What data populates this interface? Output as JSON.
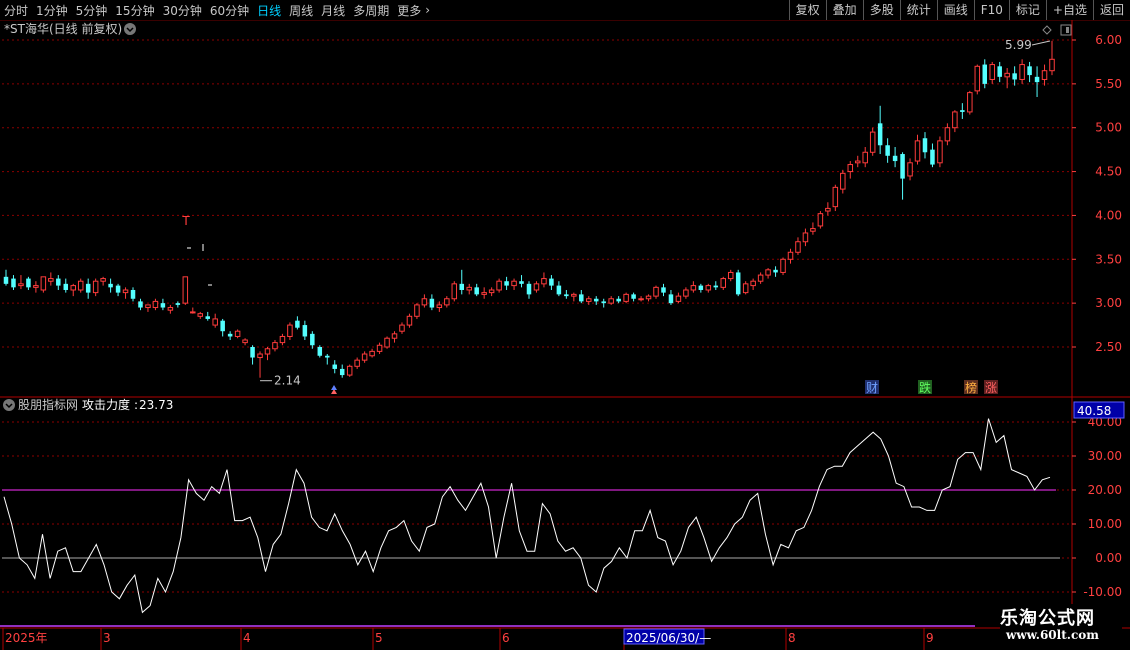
{
  "toolbar": {
    "left_items": [
      "分时",
      "1分钟",
      "5分钟",
      "15分钟",
      "30分钟",
      "60分钟",
      "日线",
      "周线",
      "月线",
      "多周期",
      "更多"
    ],
    "active": "日线",
    "right_items": [
      "复权",
      "叠加",
      "多股",
      "统计",
      "画线",
      "F10",
      "标记",
      "+自选",
      "返回"
    ]
  },
  "main_panel": {
    "title": "*ST海华(日线 前复权)",
    "max_label": "5.99",
    "min_label": "2.14",
    "event_markers": [
      "财",
      "跌",
      "榜",
      "涨"
    ],
    "t_marker": "T"
  },
  "indicator_panel": {
    "title": "股朋指标网",
    "indicator_name": "攻击力度",
    "indicator_value": "23.73",
    "current_value_box": "40.58"
  },
  "time_axis": {
    "labels": [
      "2025年",
      "3",
      "4",
      "5",
      "6",
      "2025/06/30/—",
      "8",
      "9"
    ]
  },
  "watermark": {
    "line1": "乐淘公式网",
    "line2": "www.60lt.com"
  },
  "colors": {
    "up": "#ff3c3c",
    "down": "#54ffff",
    "grid": "#8b0000",
    "indicator_line": "#ffffff",
    "level_line": "#ff30ff",
    "axis_text": "#ff4040"
  },
  "chart_data": [
    {
      "type": "candlestick",
      "title": "*ST海华(日线 前复权)",
      "y_axis": {
        "ticks": [
          2.5,
          3.0,
          3.5,
          4.0,
          4.5,
          5.0,
          5.5,
          6.0
        ],
        "range": [
          2.05,
          6.1
        ],
        "grid": true
      },
      "x_labels": [
        "2025年",
        "3",
        "4",
        "5",
        "6",
        "2025/06/30/—",
        "8",
        "9"
      ],
      "candles": [
        [
          3.3,
          3.38,
          3.22,
          3.2
        ],
        [
          3.28,
          3.32,
          3.18,
          3.15
        ],
        [
          3.2,
          3.32,
          3.22,
          3.16
        ],
        [
          3.28,
          3.3,
          3.18,
          3.15
        ],
        [
          3.18,
          3.25,
          3.2,
          3.12
        ],
        [
          3.15,
          3.22,
          3.3,
          3.12
        ],
        [
          3.25,
          3.35,
          3.28,
          3.2
        ],
        [
          3.28,
          3.32,
          3.2,
          3.15
        ],
        [
          3.22,
          3.28,
          3.15,
          3.12
        ],
        [
          3.15,
          3.22,
          3.2,
          3.08
        ],
        [
          3.15,
          3.28,
          3.25,
          3.12
        ],
        [
          3.22,
          3.28,
          3.12,
          3.05
        ],
        [
          3.12,
          3.28,
          3.25,
          3.08
        ],
        [
          3.25,
          3.3,
          3.28,
          3.2
        ],
        [
          3.22,
          3.28,
          3.18,
          3.12
        ],
        [
          3.2,
          3.22,
          3.12,
          3.08
        ],
        [
          3.12,
          3.18,
          3.15,
          3.05
        ],
        [
          3.15,
          3.18,
          3.05,
          3.02
        ],
        [
          3.02,
          3.05,
          2.95,
          2.92
        ],
        [
          2.95,
          2.98,
          2.98,
          2.9
        ],
        [
          2.95,
          3.05,
          3.02,
          2.92
        ],
        [
          3.0,
          3.05,
          2.95,
          2.92
        ],
        [
          2.92,
          2.98,
          2.95,
          2.88
        ],
        [
          3.0,
          3.02,
          2.98,
          2.95
        ],
        [
          3.0,
          3.3,
          3.3,
          2.98
        ],
        [
          2.9,
          2.95,
          2.9,
          2.88
        ],
        [
          2.85,
          2.9,
          2.88,
          2.82
        ],
        [
          2.85,
          2.9,
          2.82,
          2.8
        ],
        [
          2.75,
          2.88,
          2.82,
          2.72
        ],
        [
          2.8,
          2.82,
          2.68,
          2.62
        ],
        [
          2.65,
          2.68,
          2.62,
          2.58
        ],
        [
          2.62,
          2.7,
          2.68,
          2.6
        ],
        [
          2.55,
          2.6,
          2.58,
          2.52
        ],
        [
          2.5,
          2.52,
          2.38,
          2.3
        ],
        [
          2.38,
          2.45,
          2.42,
          2.15
        ],
        [
          2.42,
          2.5,
          2.48,
          2.35
        ],
        [
          2.48,
          2.58,
          2.55,
          2.45
        ],
        [
          2.55,
          2.65,
          2.62,
          2.52
        ],
        [
          2.62,
          2.78,
          2.75,
          2.58
        ],
        [
          2.8,
          2.85,
          2.72,
          2.7
        ],
        [
          2.75,
          2.8,
          2.62,
          2.58
        ],
        [
          2.65,
          2.68,
          2.52,
          2.48
        ],
        [
          2.5,
          2.52,
          2.4,
          2.38
        ],
        [
          2.4,
          2.42,
          2.38,
          2.3
        ],
        [
          2.3,
          2.35,
          2.25,
          2.2
        ],
        [
          2.25,
          2.3,
          2.18,
          2.15
        ],
        [
          2.18,
          2.3,
          2.28,
          2.16
        ],
        [
          2.28,
          2.38,
          2.35,
          2.25
        ],
        [
          2.35,
          2.45,
          2.42,
          2.32
        ],
        [
          2.4,
          2.48,
          2.45,
          2.38
        ],
        [
          2.45,
          2.55,
          2.52,
          2.42
        ],
        [
          2.5,
          2.62,
          2.6,
          2.48
        ],
        [
          2.6,
          2.68,
          2.65,
          2.55
        ],
        [
          2.68,
          2.78,
          2.75,
          2.65
        ],
        [
          2.75,
          2.88,
          2.85,
          2.72
        ],
        [
          2.85,
          3.0,
          2.98,
          2.82
        ],
        [
          2.98,
          3.1,
          3.05,
          2.95
        ],
        [
          3.05,
          3.1,
          2.95,
          2.92
        ],
        [
          2.95,
          3.02,
          2.98,
          2.9
        ],
        [
          2.98,
          3.08,
          3.05,
          2.95
        ],
        [
          3.05,
          3.25,
          3.22,
          3.02
        ],
        [
          3.22,
          3.38,
          3.15,
          3.1
        ],
        [
          3.15,
          3.22,
          3.18,
          3.1
        ],
        [
          3.18,
          3.22,
          3.1,
          3.08
        ],
        [
          3.1,
          3.18,
          3.12,
          3.05
        ],
        [
          3.12,
          3.18,
          3.15,
          3.08
        ],
        [
          3.15,
          3.28,
          3.25,
          3.12
        ],
        [
          3.25,
          3.3,
          3.2,
          3.15
        ],
        [
          3.2,
          3.28,
          3.25,
          3.15
        ],
        [
          3.25,
          3.32,
          3.22,
          3.18
        ],
        [
          3.22,
          3.25,
          3.1,
          3.05
        ],
        [
          3.15,
          3.25,
          3.22,
          3.12
        ],
        [
          3.22,
          3.35,
          3.28,
          3.18
        ],
        [
          3.28,
          3.32,
          3.2,
          3.15
        ],
        [
          3.2,
          3.25,
          3.1,
          3.08
        ],
        [
          3.1,
          3.15,
          3.08,
          3.05
        ],
        [
          3.08,
          3.12,
          3.1,
          3.02
        ],
        [
          3.1,
          3.15,
          3.02,
          3.0
        ],
        [
          3.02,
          3.08,
          3.05,
          2.98
        ],
        [
          3.05,
          3.08,
          3.02,
          2.98
        ],
        [
          3.02,
          3.05,
          3.0,
          2.95
        ],
        [
          3.0,
          3.08,
          3.05,
          2.98
        ],
        [
          3.05,
          3.08,
          3.02,
          3.0
        ],
        [
          3.02,
          3.12,
          3.1,
          3.0
        ],
        [
          3.1,
          3.12,
          3.05,
          3.02
        ],
        [
          3.05,
          3.08,
          3.05,
          3.02
        ],
        [
          3.05,
          3.1,
          3.08,
          3.02
        ],
        [
          3.08,
          3.2,
          3.18,
          3.05
        ],
        [
          3.18,
          3.22,
          3.12,
          3.08
        ],
        [
          3.1,
          3.15,
          3.0,
          2.98
        ],
        [
          3.02,
          3.12,
          3.08,
          3.0
        ],
        [
          3.08,
          3.18,
          3.15,
          3.05
        ],
        [
          3.15,
          3.25,
          3.2,
          3.12
        ],
        [
          3.2,
          3.22,
          3.15,
          3.12
        ],
        [
          3.15,
          3.22,
          3.2,
          3.12
        ],
        [
          3.2,
          3.25,
          3.18,
          3.15
        ],
        [
          3.18,
          3.3,
          3.28,
          3.15
        ],
        [
          3.28,
          3.38,
          3.35,
          3.25
        ],
        [
          3.35,
          3.38,
          3.1,
          3.08
        ],
        [
          3.12,
          3.25,
          3.22,
          3.1
        ],
        [
          3.2,
          3.28,
          3.25,
          3.15
        ],
        [
          3.25,
          3.35,
          3.32,
          3.22
        ],
        [
          3.32,
          3.4,
          3.38,
          3.28
        ],
        [
          3.38,
          3.42,
          3.35,
          3.3
        ],
        [
          3.35,
          3.52,
          3.5,
          3.32
        ],
        [
          3.5,
          3.62,
          3.58,
          3.45
        ],
        [
          3.58,
          3.75,
          3.7,
          3.55
        ],
        [
          3.7,
          3.85,
          3.8,
          3.65
        ],
        [
          3.82,
          3.92,
          3.85,
          3.78
        ],
        [
          3.88,
          4.05,
          4.02,
          3.85
        ],
        [
          4.05,
          4.15,
          4.08,
          4.0
        ],
        [
          4.1,
          4.35,
          4.32,
          4.05
        ],
        [
          4.3,
          4.52,
          4.48,
          4.25
        ],
        [
          4.5,
          4.62,
          4.58,
          4.42
        ],
        [
          4.6,
          4.68,
          4.62,
          4.55
        ],
        [
          4.6,
          4.78,
          4.72,
          4.55
        ],
        [
          4.72,
          5.0,
          4.95,
          4.68
        ],
        [
          5.05,
          5.25,
          4.8,
          4.7
        ],
        [
          4.8,
          4.88,
          4.68,
          4.6
        ],
        [
          4.68,
          4.78,
          4.62,
          4.55
        ],
        [
          4.7,
          4.72,
          4.42,
          4.18
        ],
        [
          4.45,
          4.65,
          4.6,
          4.4
        ],
        [
          4.62,
          4.92,
          4.85,
          4.58
        ],
        [
          4.88,
          4.95,
          4.72,
          4.65
        ],
        [
          4.75,
          4.82,
          4.58,
          4.55
        ],
        [
          4.6,
          4.9,
          4.85,
          4.55
        ],
        [
          4.85,
          5.05,
          5.0,
          4.8
        ],
        [
          5.0,
          5.2,
          5.18,
          4.95
        ],
        [
          5.2,
          5.28,
          5.18,
          5.1
        ],
        [
          5.18,
          5.42,
          5.4,
          5.15
        ],
        [
          5.42,
          5.72,
          5.7,
          5.38
        ],
        [
          5.72,
          5.78,
          5.5,
          5.45
        ],
        [
          5.55,
          5.75,
          5.72,
          5.5
        ],
        [
          5.7,
          5.75,
          5.58,
          5.52
        ],
        [
          5.58,
          5.68,
          5.62,
          5.45
        ],
        [
          5.62,
          5.7,
          5.55,
          5.48
        ],
        [
          5.55,
          5.78,
          5.72,
          5.5
        ],
        [
          5.7,
          5.75,
          5.6,
          5.52
        ],
        [
          5.58,
          5.7,
          5.52,
          5.35
        ],
        [
          5.55,
          5.72,
          5.65,
          5.48
        ],
        [
          5.65,
          5.99,
          5.78,
          5.6
        ]
      ]
    },
    {
      "type": "line",
      "title": "攻击力度",
      "y_axis": {
        "ticks": [
          -10.0,
          0.0,
          10.0,
          20.0,
          30.0,
          40.0
        ],
        "range": [
          -10.5,
          42
        ],
        "grid": true
      },
      "reference_lines": [
        20,
        0
      ],
      "values": [
        18,
        10,
        0,
        -2,
        -6,
        7,
        -6,
        2,
        3,
        -4,
        -4,
        0,
        4,
        -2,
        -10,
        -12,
        -8,
        -5,
        -16,
        -14,
        -6,
        -10,
        -4,
        6,
        23,
        19,
        17,
        21,
        19,
        26,
        11,
        11,
        12,
        6,
        -4,
        4,
        7,
        16,
        26,
        22,
        12,
        9,
        8,
        13,
        8,
        4,
        -2,
        2,
        -4,
        3,
        8,
        9,
        11,
        5,
        2,
        9,
        10,
        18,
        21,
        17,
        14,
        18,
        22,
        15,
        0,
        12,
        22,
        8,
        2,
        2,
        16,
        13,
        5,
        2,
        3,
        0,
        -8,
        -10,
        -3,
        -1,
        3,
        0,
        8,
        8,
        14,
        6,
        5,
        -2,
        2,
        9,
        12,
        6,
        -1,
        3,
        6,
        10,
        12,
        17,
        19,
        7,
        -2,
        4,
        3,
        8,
        9,
        14,
        21,
        26,
        27,
        27,
        31,
        33,
        35,
        37,
        35,
        30,
        22,
        21,
        15,
        15,
        14,
        14,
        20,
        21,
        29,
        31,
        31,
        26,
        41,
        34,
        36,
        26,
        25,
        24,
        20,
        23,
        23.73
      ]
    }
  ]
}
